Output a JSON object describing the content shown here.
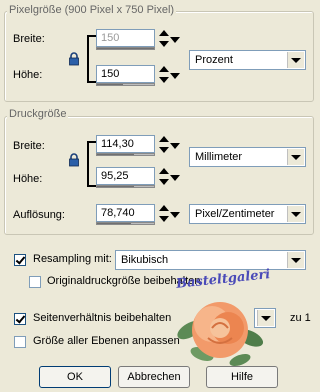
{
  "pixel_group": {
    "legend": "Pixelgröße (900 Pixel x 750 Pixel)",
    "width_label": "Breite:",
    "width_value": "150",
    "height_label": "Höhe:",
    "height_value": "150",
    "unit_selected": "Prozent"
  },
  "print_group": {
    "legend": "Druckgröße",
    "width_label": "Breite:",
    "width_value": "114,30",
    "height_label": "Höhe:",
    "height_value": "95,25",
    "unit_selected": "Millimeter",
    "resolution_label": "Auflösung:",
    "resolution_value": "78,740",
    "resolution_unit": "Pixel/Zentimeter"
  },
  "options": {
    "resample_label": "Resampling mit:",
    "resample_checked": true,
    "resample_method": "Bikubisch",
    "keep_print_label": "Originaldruckgröße beibehalten",
    "keep_print_checked": false,
    "aspect_label": "Seitenverhältnis beibehalten",
    "aspect_checked": true,
    "aspect_suffix": "zu 1",
    "all_layers_label": "Größe aller Ebenen anpassen",
    "all_layers_checked": false
  },
  "watermark_text": "Basteltgaleri",
  "buttons": {
    "ok": "OK",
    "cancel": "Abbrechen",
    "help": "Hilfe"
  },
  "colors": {
    "dialog_bg": "#ece9d8",
    "field_border": "#7f9db9",
    "button_border": "#003c74"
  }
}
